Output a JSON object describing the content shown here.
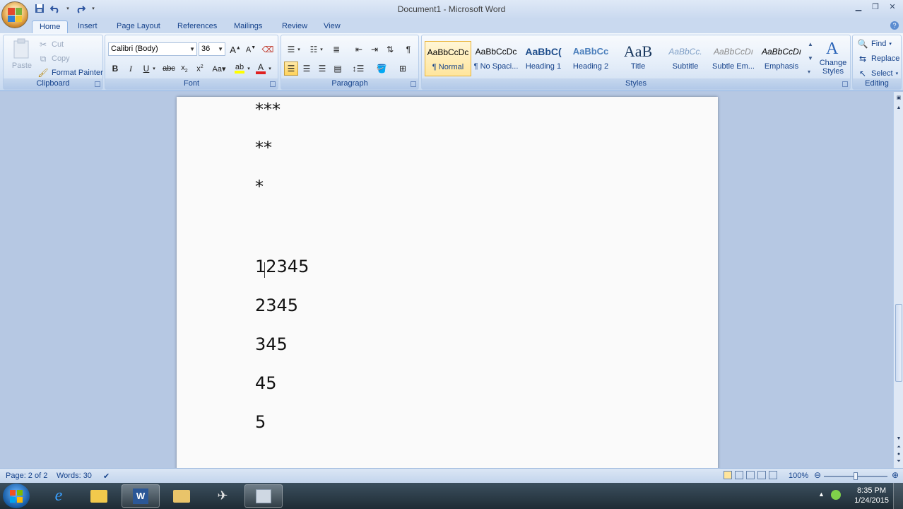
{
  "window": {
    "title": "Document1 - Microsoft Word"
  },
  "tabs": [
    "Home",
    "Insert",
    "Page Layout",
    "References",
    "Mailings",
    "Review",
    "View"
  ],
  "clipboard": {
    "paste": "Paste",
    "cut": "Cut",
    "copy": "Copy",
    "format_painter": "Format Painter",
    "label": "Clipboard"
  },
  "font": {
    "name": "Calibri (Body)",
    "size": "36",
    "label": "Font"
  },
  "paragraph": {
    "label": "Paragraph"
  },
  "styles": {
    "label": "Styles",
    "items": [
      {
        "sample": "AaBbCcDc",
        "name": "¶ Normal"
      },
      {
        "sample": "AaBbCcDc",
        "name": "¶ No Spaci..."
      },
      {
        "sample": "AaBbC(",
        "name": "Heading 1"
      },
      {
        "sample": "AaBbCc",
        "name": "Heading 2"
      },
      {
        "sample": "AaB",
        "name": "Title"
      },
      {
        "sample": "AaBbCc.",
        "name": "Subtitle"
      },
      {
        "sample": "AaBbCcDı",
        "name": "Subtle Em..."
      },
      {
        "sample": "AaBbCcDı",
        "name": "Emphasis"
      }
    ],
    "change_styles": "Change Styles"
  },
  "editing": {
    "find": "Find",
    "replace": "Replace",
    "select": "Select",
    "label": "Editing"
  },
  "document": {
    "lines": [
      "***",
      "**",
      "*",
      "12345",
      "2345",
      "345",
      "45",
      "5"
    ]
  },
  "status": {
    "page": "Page: 2 of 2",
    "words": "Words: 30",
    "zoom": "100%",
    "zoom_level": 0.5
  },
  "taskbar": {
    "time": "8:35 PM",
    "date": "1/24/2015"
  }
}
